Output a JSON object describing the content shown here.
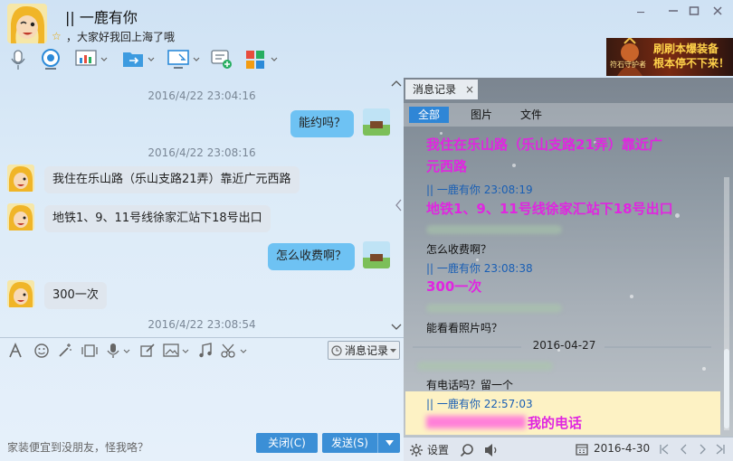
{
  "header": {
    "title": "|| 一鹿有你",
    "signature": "，大家好我回上海了哦",
    "window_controls": [
      "minimize-icon",
      "maximize-icon",
      "close-icon"
    ],
    "toolbar_icons": [
      "microphone-icon",
      "webcam-icon",
      "screen-share-icon",
      "file-transfer-icon",
      "remote-desktop-icon",
      "invite-chat-icon",
      "apps-icon"
    ]
  },
  "ad": {
    "text": "刷刷本爆装备 根本停不下来！",
    "logo": "符石守护者"
  },
  "chat": {
    "timestamps": [
      "2016/4/22 23:04:16",
      "2016/4/22 23:08:16",
      "2016/4/22 23:08:54"
    ],
    "messages": [
      {
        "side": "right",
        "text": "能约吗？"
      },
      {
        "side": "left",
        "text": "我住在乐山路（乐山支路21弄）靠近广元西路"
      },
      {
        "side": "left",
        "text": "地铁1、9、11号线徐家汇站下18号出口"
      },
      {
        "side": "right",
        "text": "怎么收费啊？"
      },
      {
        "side": "left",
        "text": "300一次"
      }
    ]
  },
  "input_toolbar": {
    "history_button": "消息记录"
  },
  "footer": {
    "hint": "家装便宜到没朋友，怪我咯？",
    "close_button": "关闭(C)",
    "send_button": "发送(S)"
  },
  "history_panel": {
    "tab_label": "消息记录",
    "filters": [
      "全部",
      "图片",
      "文件"
    ],
    "active_filter": "全部",
    "msg1_line1": "我住在乐山路（乐山支路21弄）靠近广",
    "msg1_line2": "元西路",
    "sender1": "|| 一鹿有你 23:08:19",
    "msg2": "地铁1、9、11号线徐家汇站下18号出口",
    "plain1": "怎么收费啊？",
    "sender2": "|| 一鹿有你 23:08:38",
    "msg3": "300一次",
    "plain2": "能看看照片吗？",
    "date_separator": "2016-04-27",
    "plain3": "有电话吗？留一个",
    "sender3": "|| 一鹿有你 22:57:03",
    "msg4_suffix": "我的电话"
  },
  "history_footer": {
    "settings_label": "设置",
    "date": "2016-4-30"
  },
  "colors": {
    "accent": "#3b8fd6",
    "highlight_text": "#e026e0",
    "sender_name": "#1a5fb4",
    "bubble_self": "#6ec2f3",
    "bubble_other": "#dfe6ee",
    "filter_active": "#2f86d6"
  }
}
